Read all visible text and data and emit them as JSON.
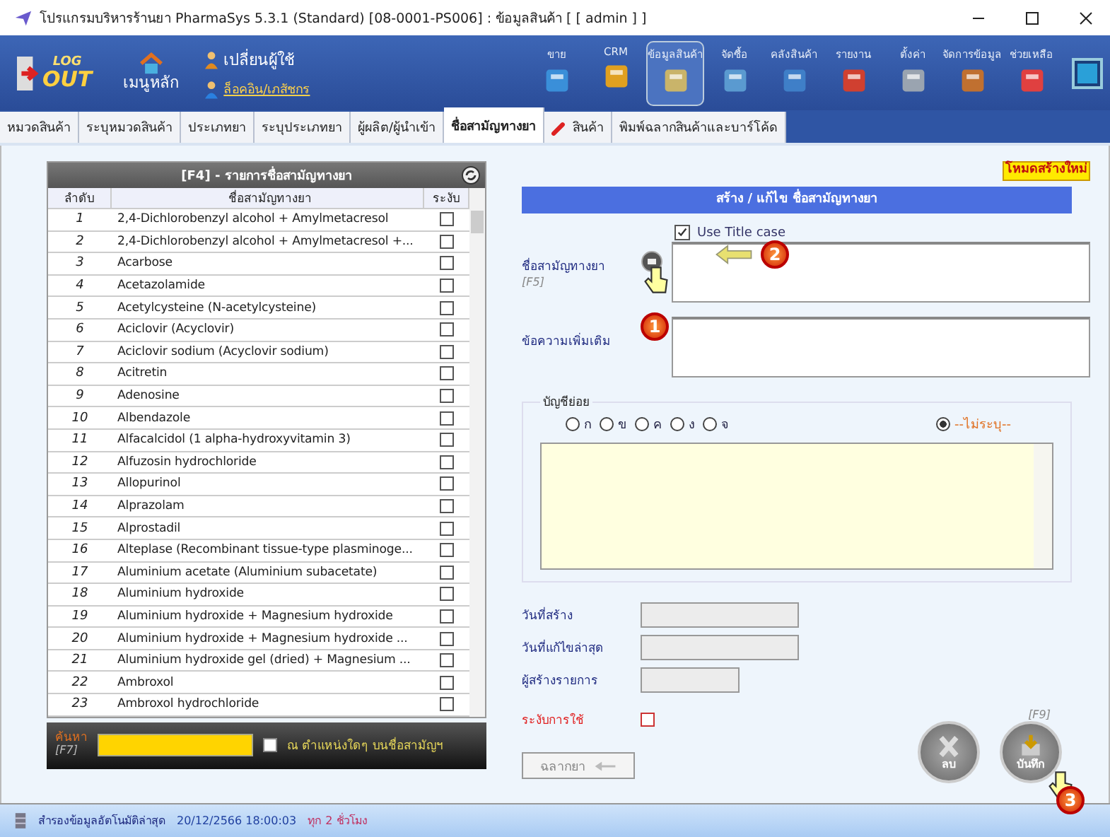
{
  "window": {
    "title": "โปรแกรมบริหารร้านยา PharmaSys 5.3.1 (Standard) [08-0001-PS006] : ข้อมูลสินค้า  [ [ admin ] ]"
  },
  "toolbar": {
    "logout": {
      "line1": "LOG",
      "line2": "OUT"
    },
    "home": "เมนูหลัก",
    "switch_user": "เปลี่ยนผู้ใช้",
    "login_link": "ล็อคอิน/เภสัชกร",
    "modules": [
      {
        "label": "ขาย",
        "selected": false
      },
      {
        "label": "CRM",
        "selected": false
      },
      {
        "label": "ข้อมูลสินค้า",
        "selected": true
      },
      {
        "label": "จัดซื้อ",
        "selected": false
      },
      {
        "label": "คลังสินค้า",
        "selected": false
      },
      {
        "label": "รายงาน",
        "selected": false
      },
      {
        "label": "ตั้งค่า",
        "selected": false
      },
      {
        "label": "จัดการข้อมูล",
        "selected": false
      },
      {
        "label": "ช่วยเหลือ",
        "selected": false
      }
    ]
  },
  "tabs": [
    {
      "label": "หมวดสินค้า",
      "selected": false
    },
    {
      "label": "ระบุหมวดสินค้า",
      "selected": false
    },
    {
      "label": "ประเภทยา",
      "selected": false
    },
    {
      "label": "ระบุประเภทยา",
      "selected": false
    },
    {
      "label": "ผู้ผลิต/ผู้นำเข้า",
      "selected": false
    },
    {
      "label": "ชื่อสามัญทางยา",
      "selected": true
    },
    {
      "label": "สินค้า",
      "selected": false,
      "kind": "icon"
    },
    {
      "label": "พิมพ์ฉลากสินค้าและบาร์โค้ด",
      "selected": false
    }
  ],
  "mode_badge": "โหมดสร้างใหม่",
  "list": {
    "title": "[F4] - รายการชื่อสามัญทางยา",
    "columns": [
      "ลำดับ",
      "ชื่อสามัญทางยา",
      "ระงับ"
    ],
    "rows": [
      {
        "no": "1",
        "name": "2,4-Dichlorobenzyl alcohol + Amylmetacresol",
        "suspended": false
      },
      {
        "no": "2",
        "name": "2,4-Dichlorobenzyl alcohol + Amylmetacresol +...",
        "suspended": false
      },
      {
        "no": "3",
        "name": "Acarbose",
        "suspended": false
      },
      {
        "no": "4",
        "name": "Acetazolamide",
        "suspended": false
      },
      {
        "no": "5",
        "name": "Acetylcysteine (N-acetylcysteine)",
        "suspended": false
      },
      {
        "no": "6",
        "name": "Aciclovir (Acyclovir)",
        "suspended": false
      },
      {
        "no": "7",
        "name": "Aciclovir sodium (Acyclovir sodium)",
        "suspended": false
      },
      {
        "no": "8",
        "name": "Acitretin",
        "suspended": false
      },
      {
        "no": "9",
        "name": "Adenosine",
        "suspended": false
      },
      {
        "no": "10",
        "name": "Albendazole",
        "suspended": false
      },
      {
        "no": "11",
        "name": "Alfacalcidol (1 alpha-hydroxyvitamin 3)",
        "suspended": false
      },
      {
        "no": "12",
        "name": "Alfuzosin hydrochloride",
        "suspended": false
      },
      {
        "no": "13",
        "name": "Allopurinol",
        "suspended": false
      },
      {
        "no": "14",
        "name": "Alprazolam",
        "suspended": false
      },
      {
        "no": "15",
        "name": "Alprostadil",
        "suspended": false
      },
      {
        "no": "16",
        "name": "Alteplase (Recombinant tissue-type plasminoge...",
        "suspended": false
      },
      {
        "no": "17",
        "name": "Aluminium acetate (Aluminium subacetate)",
        "suspended": false
      },
      {
        "no": "18",
        "name": "Aluminium hydroxide",
        "suspended": false
      },
      {
        "no": "19",
        "name": "Aluminium hydroxide + Magnesium hydroxide",
        "suspended": false
      },
      {
        "no": "20",
        "name": "Aluminium hydroxide + Magnesium hydroxide ...",
        "suspended": false
      },
      {
        "no": "21",
        "name": "Aluminium hydroxide gel (dried) + Magnesium ...",
        "suspended": false
      },
      {
        "no": "22",
        "name": "Ambroxol",
        "suspended": false
      },
      {
        "no": "23",
        "name": "Ambroxol hydrochloride",
        "suspended": false
      }
    ],
    "search": {
      "label": "ค้นหา",
      "key": "[F7]",
      "anywhere_label": "ณ ตำแหน่งใดๆ บนชื่อสามัญฯ",
      "anywhere_checked": false
    }
  },
  "form": {
    "title": "สร้าง / แก้ไข ชื่อสามัญทางยา",
    "title_case": {
      "label": "Use Title case",
      "checked": true
    },
    "name_label": "ชื่อสามัญทางยา",
    "name_key": "[F5]",
    "note_label": "ข้อความเพิ่มเติม",
    "subaccount": {
      "legend": "บัญชีย่อย",
      "options": [
        {
          "label": "ก",
          "selected": false
        },
        {
          "label": "ข",
          "selected": false
        },
        {
          "label": "ค",
          "selected": false
        },
        {
          "label": "ง",
          "selected": false
        },
        {
          "label": "จ",
          "selected": false
        },
        {
          "label": "--ไม่ระบุ--",
          "selected": true
        }
      ]
    },
    "created_label": "วันที่สร้าง",
    "modified_label": "วันที่แก้ไขล่าสุด",
    "creator_label": "ผู้สร้างรายการ",
    "suspend": {
      "label": "ระงับการใช้",
      "checked": false
    },
    "label_button": "ฉลากยา",
    "delete_button": "ลบ",
    "save_key": "[F9]",
    "save_button": "บันทึก"
  },
  "annotations": [
    "1",
    "2",
    "3"
  ],
  "status_bar": {
    "label": "สำรองข้อมูลอัตโนมัติล่าสุด",
    "time": "20/12/2566 18:00:03",
    "interval": "ทุก 2 ชั่วโมง"
  }
}
